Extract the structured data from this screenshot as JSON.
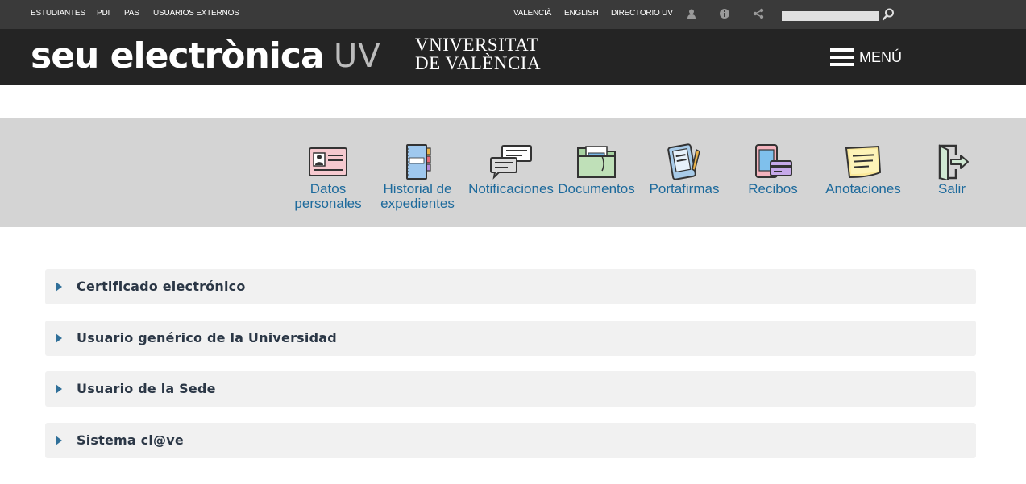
{
  "topbar": {
    "links": [
      "ESTUDIANTES",
      "PDI",
      "PAS",
      "USUARIOS EXTERNOS"
    ],
    "right_links": [
      "VALENCIÀ",
      "ENGLISH",
      "DIRECTORIO UV"
    ],
    "icons": [
      "user-icon",
      "info-icon",
      "share-icon"
    ],
    "search": {
      "value": "",
      "placeholder": ""
    }
  },
  "header": {
    "brand_main": "seu electrònica",
    "brand_suffix": "UV",
    "university_line1": "VNIVERSITAT",
    "university_line2": "DE VALÈNCIA",
    "menu_label": "MENÚ"
  },
  "nav": {
    "items": [
      {
        "label_line1": "Datos",
        "label_line2": "personales",
        "icon": "id-card-icon"
      },
      {
        "label_line1": "Historial de",
        "label_line2": "expedientes",
        "icon": "binder-icon"
      },
      {
        "label_line1": "Notificaciones",
        "label_line2": "",
        "icon": "chat-bubbles-icon"
      },
      {
        "label_line1": "Documentos",
        "label_line2": "",
        "icon": "folder-icon"
      },
      {
        "label_line1": "Portafirmas",
        "label_line2": "",
        "icon": "tablet-pen-icon"
      },
      {
        "label_line1": "Recibos",
        "label_line2": "",
        "icon": "phone-card-icon"
      },
      {
        "label_line1": "Anotaciones",
        "label_line2": "",
        "icon": "sticky-note-icon"
      },
      {
        "label_line1": "Salir",
        "label_line2": "",
        "icon": "exit-icon"
      }
    ]
  },
  "login_options": [
    {
      "label": "Certificado electrónico"
    },
    {
      "label": "Usuario genérico de la Universidad"
    },
    {
      "label": "Usuario de la Sede"
    },
    {
      "label": "Sistema cl@ve"
    }
  ],
  "colors": {
    "topbar_bg": "#3a3a3a",
    "header_bg": "#242424",
    "nav_bg": "#d4d4d4",
    "link_blue": "#1d6a9c",
    "accordion_bg": "#f1f1f1"
  }
}
